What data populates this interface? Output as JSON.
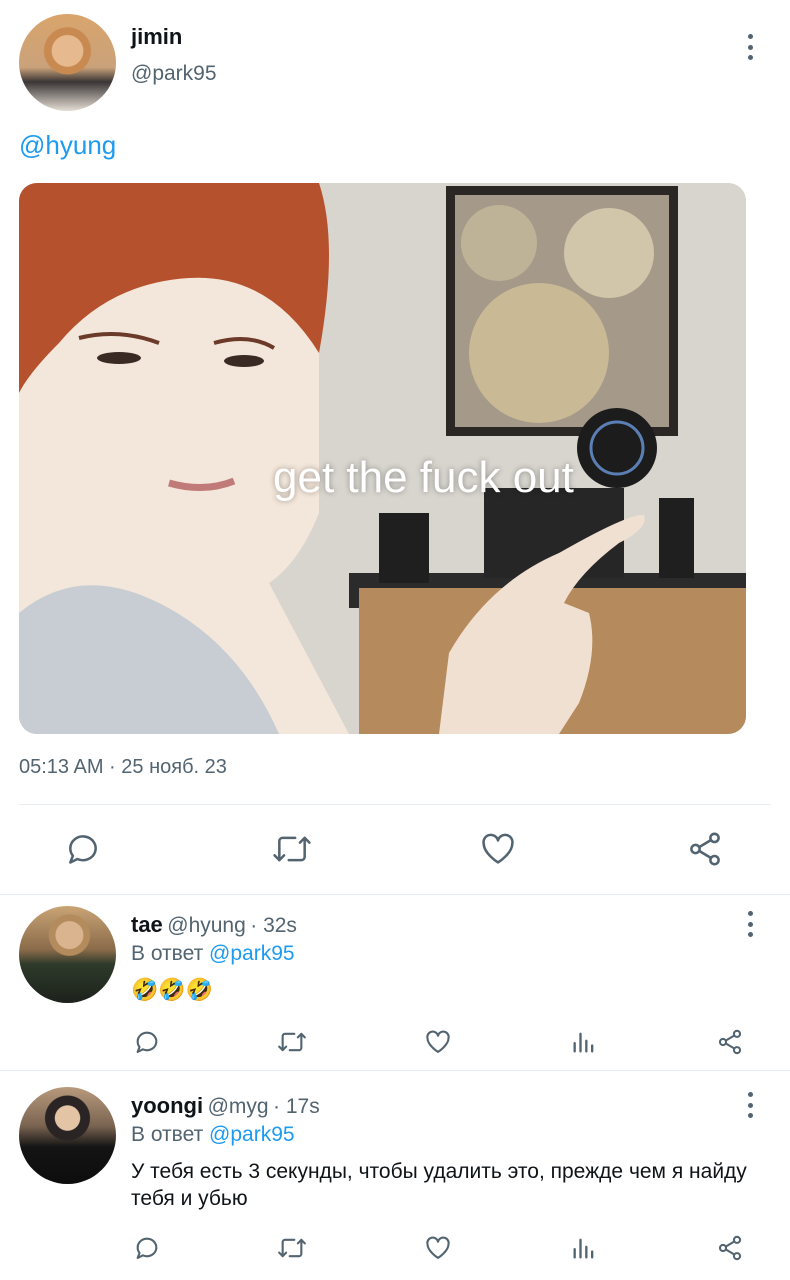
{
  "tweet": {
    "author_name": "jimin",
    "author_handle": "@park95",
    "text_mention": "@hyung",
    "image_caption": "get the fuck out",
    "timestamp": "05:13 AM · 25 нояб. 23"
  },
  "replies": [
    {
      "name": "tae",
      "handle": "@hyung",
      "time": "· 32s",
      "reply_prefix": "В ответ",
      "reply_to": "@park95",
      "text": "🤣🤣🤣"
    },
    {
      "name": "yoongi",
      "handle": "@myg",
      "time": "· 17s",
      "reply_prefix": "В ответ",
      "reply_to": "@park95",
      "text": "У тебя есть 3 секунды, чтобы удалить это, прежде чем я найду тебя и убью"
    }
  ],
  "icons": {
    "reply": "reply-icon",
    "retweet": "retweet-icon",
    "like": "heart-icon",
    "views": "views-icon",
    "share": "share-icon",
    "more": "more-icon"
  },
  "colors": {
    "accent": "#1d9bf0",
    "secondary_text": "#536471",
    "icon": "#536471"
  }
}
